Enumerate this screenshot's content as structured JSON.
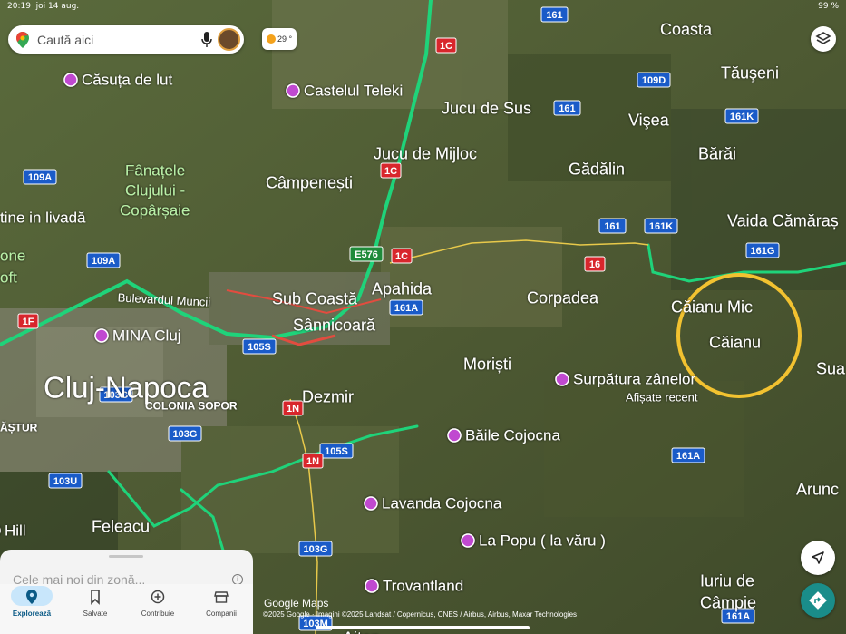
{
  "status_bar": {
    "time": "20:19",
    "date": "joi 14 aug.",
    "battery": "99 %"
  },
  "search": {
    "placeholder": "Caută aici"
  },
  "weather": {
    "temp": "29 °"
  },
  "places": [
    {
      "name": "Coasta",
      "style": "town"
    },
    {
      "name": "Tăuşeni",
      "style": "town"
    },
    {
      "name": "Căsuța de lut",
      "style": "poi"
    },
    {
      "name": "Castelul Teleki",
      "style": "poi"
    },
    {
      "name": "Jucu de Sus",
      "style": "town"
    },
    {
      "name": "Vişea",
      "style": "town"
    },
    {
      "name": "Jucu de Mijloc",
      "style": "town"
    },
    {
      "name": "Bărăi",
      "style": "town"
    },
    {
      "name": "Fânațele Clujului - Copârșaie",
      "style": "park"
    },
    {
      "name": "Câmpenești",
      "style": "town"
    },
    {
      "name": "Gădălin",
      "style": "town"
    },
    {
      "name": "tine in livadă",
      "style": "poi"
    },
    {
      "name": "Vaida Cămăraș",
      "style": "town"
    },
    {
      "name": "one",
      "style": "park"
    },
    {
      "name": "oft",
      "style": "park"
    },
    {
      "name": "Bulevardul Muncii",
      "style": "road"
    },
    {
      "name": "Sub Coastă",
      "style": "town"
    },
    {
      "name": "Apahida",
      "style": "town"
    },
    {
      "name": "Corpadea",
      "style": "town"
    },
    {
      "name": "Căianu Mic",
      "style": "town"
    },
    {
      "name": "MINA Cluj",
      "style": "poi"
    },
    {
      "name": "Sânnicoară",
      "style": "town"
    },
    {
      "name": "Căianu",
      "style": "town"
    },
    {
      "name": "Cluj-Napoca",
      "style": "city"
    },
    {
      "name": "Moriști",
      "style": "town"
    },
    {
      "name": "Surpătura zânelor",
      "style": "poi"
    },
    {
      "name": "Afișate recent",
      "style": "sub"
    },
    {
      "name": "Sua",
      "style": "town"
    },
    {
      "name": "COLONIA SOPOR",
      "style": "district"
    },
    {
      "name": "Dezmir",
      "style": "town"
    },
    {
      "name": "ĂȘTUR",
      "style": "district"
    },
    {
      "name": "Băile Cojocna",
      "style": "poi"
    },
    {
      "name": "Arunc",
      "style": "town"
    },
    {
      "name": "Lavanda Cojocna",
      "style": "poi"
    },
    {
      "name": "Hill",
      "style": "poi"
    },
    {
      "name": "Feleacu",
      "style": "town"
    },
    {
      "name": "La Popu ( la văru )",
      "style": "poi"
    },
    {
      "name": "Trovantland",
      "style": "poi"
    },
    {
      "name": "Iuriu de Câmpie",
      "style": "town"
    },
    {
      "name": "Aiton",
      "style": "town"
    }
  ],
  "road_shields": [
    {
      "label": "161",
      "color": "blue"
    },
    {
      "label": "1C",
      "color": "red"
    },
    {
      "label": "109D",
      "color": "blue"
    },
    {
      "label": "161",
      "color": "blue"
    },
    {
      "label": "161K",
      "color": "blue"
    },
    {
      "label": "109A",
      "color": "blue"
    },
    {
      "label": "1C",
      "color": "red"
    },
    {
      "label": "161",
      "color": "blue"
    },
    {
      "label": "161K",
      "color": "blue"
    },
    {
      "label": "161G",
      "color": "blue"
    },
    {
      "label": "E576",
      "color": "green"
    },
    {
      "label": "1C",
      "color": "red"
    },
    {
      "label": "16",
      "color": "red"
    },
    {
      "label": "109A",
      "color": "blue"
    },
    {
      "label": "161A",
      "color": "blue"
    },
    {
      "label": "1F",
      "color": "red"
    },
    {
      "label": "105S",
      "color": "blue"
    },
    {
      "label": "103G",
      "color": "blue"
    },
    {
      "label": "1N",
      "color": "red"
    },
    {
      "label": "103G",
      "color": "blue"
    },
    {
      "label": "105S",
      "color": "blue"
    },
    {
      "label": "1N",
      "color": "red"
    },
    {
      "label": "161A",
      "color": "blue"
    },
    {
      "label": "103U",
      "color": "blue"
    },
    {
      "label": "103G",
      "color": "blue"
    },
    {
      "label": "103M",
      "color": "blue"
    },
    {
      "label": "161A",
      "color": "blue"
    }
  ],
  "panel": {
    "hint": "Cele mai noi din zonă..."
  },
  "tabs": [
    {
      "label": "Explorează",
      "icon": "location-pin-icon"
    },
    {
      "label": "Salvate",
      "icon": "bookmark-icon"
    },
    {
      "label": "Contribuie",
      "icon": "plus-circle-icon"
    },
    {
      "label": "Companii",
      "icon": "store-icon"
    }
  ],
  "footer": {
    "logo": "Google Maps",
    "attribution": "©2025 Google · Imagini ©2025 Landsat / Copernicus, CNES / Airbus, Airbus, Maxar Technologies"
  },
  "colors": {
    "highway": "#1fd37a",
    "circle": "#f2c230",
    "accent": "#1a73e8"
  }
}
